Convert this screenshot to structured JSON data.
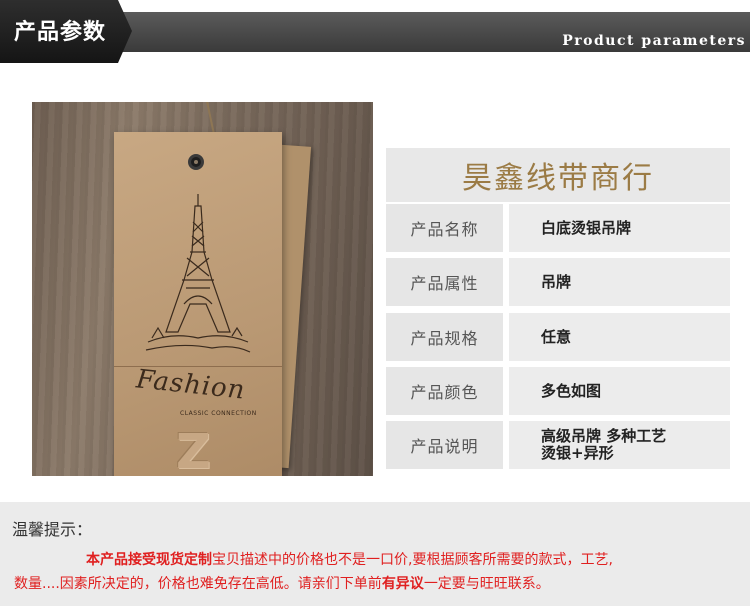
{
  "header": {
    "title_cn": "产品参数",
    "title_en": "Product parameters"
  },
  "photo": {
    "brand_script": "Fashion",
    "tagline": "CLASSIC CONNECTION",
    "emboss_letter": "Z"
  },
  "panel": {
    "brand": "昊鑫线带商行",
    "rows": [
      {
        "label": "产品名称",
        "value": "白底烫银吊牌"
      },
      {
        "label": "产品属性",
        "value": "吊牌"
      },
      {
        "label": "产品规格",
        "value": "任意"
      },
      {
        "label": "产品颜色",
        "value": "多色如图"
      },
      {
        "label": "产品说明",
        "value": "高级吊牌  多种工艺\n烫银+异形"
      }
    ]
  },
  "notice": {
    "title": "温馨提示：",
    "line1_a": "本产品接受现货定制",
    "line1_b": "宝贝描述中的价格也不是一口价,要根据顾客所需要的款式，工艺,",
    "line2_a": "数量....因素所决定的，价格也难免存在高低。请亲们下单前",
    "line2_b": "有异议",
    "line2_c": "一定要与旺旺联系。"
  },
  "colors": {
    "brand_gold": "#9b7b45",
    "notice_red": "#e02020",
    "header_dark": "#2e2e2e"
  }
}
